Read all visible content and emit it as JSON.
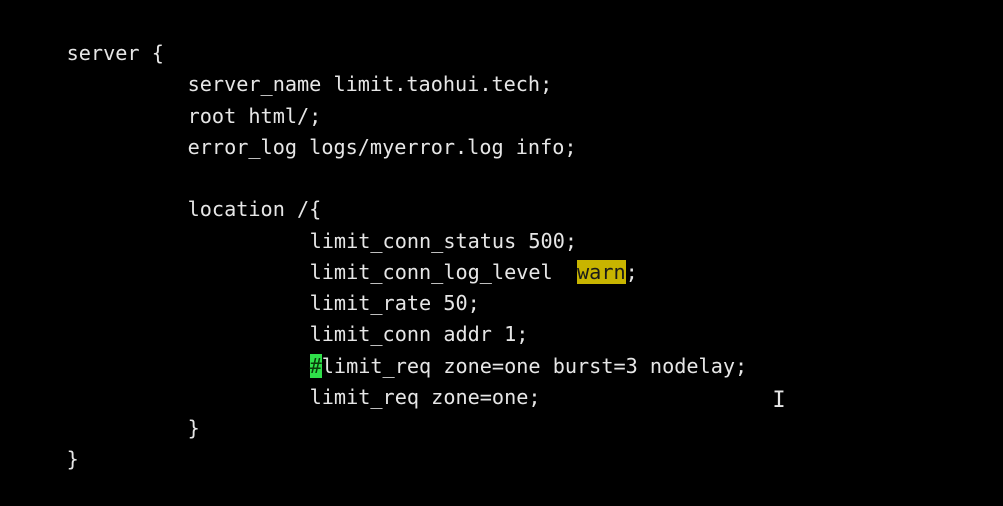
{
  "editor": {
    "lines": [
      "server {",
      "server_name limit.taohui.tech;",
      "root html/;",
      "error_log logs/myerror.log info;",
      "",
      "location /{",
      "limit_conn_status 500;",
      "limit_conn_log_level  ",
      "warn",
      ";",
      "limit_rate 50;",
      "limit_conn addr 1;",
      "#",
      "limit_req zone=one burst=3 nodelay;",
      "limit_req zone=one;",
      "}",
      "}"
    ],
    "highlight_color": "#c8b400",
    "cursor_color": "#2fe04a",
    "text_color": "#e6e6e6",
    "background_color": "#000000",
    "mouse_cursor_icon": "text-ibeam-icon"
  }
}
